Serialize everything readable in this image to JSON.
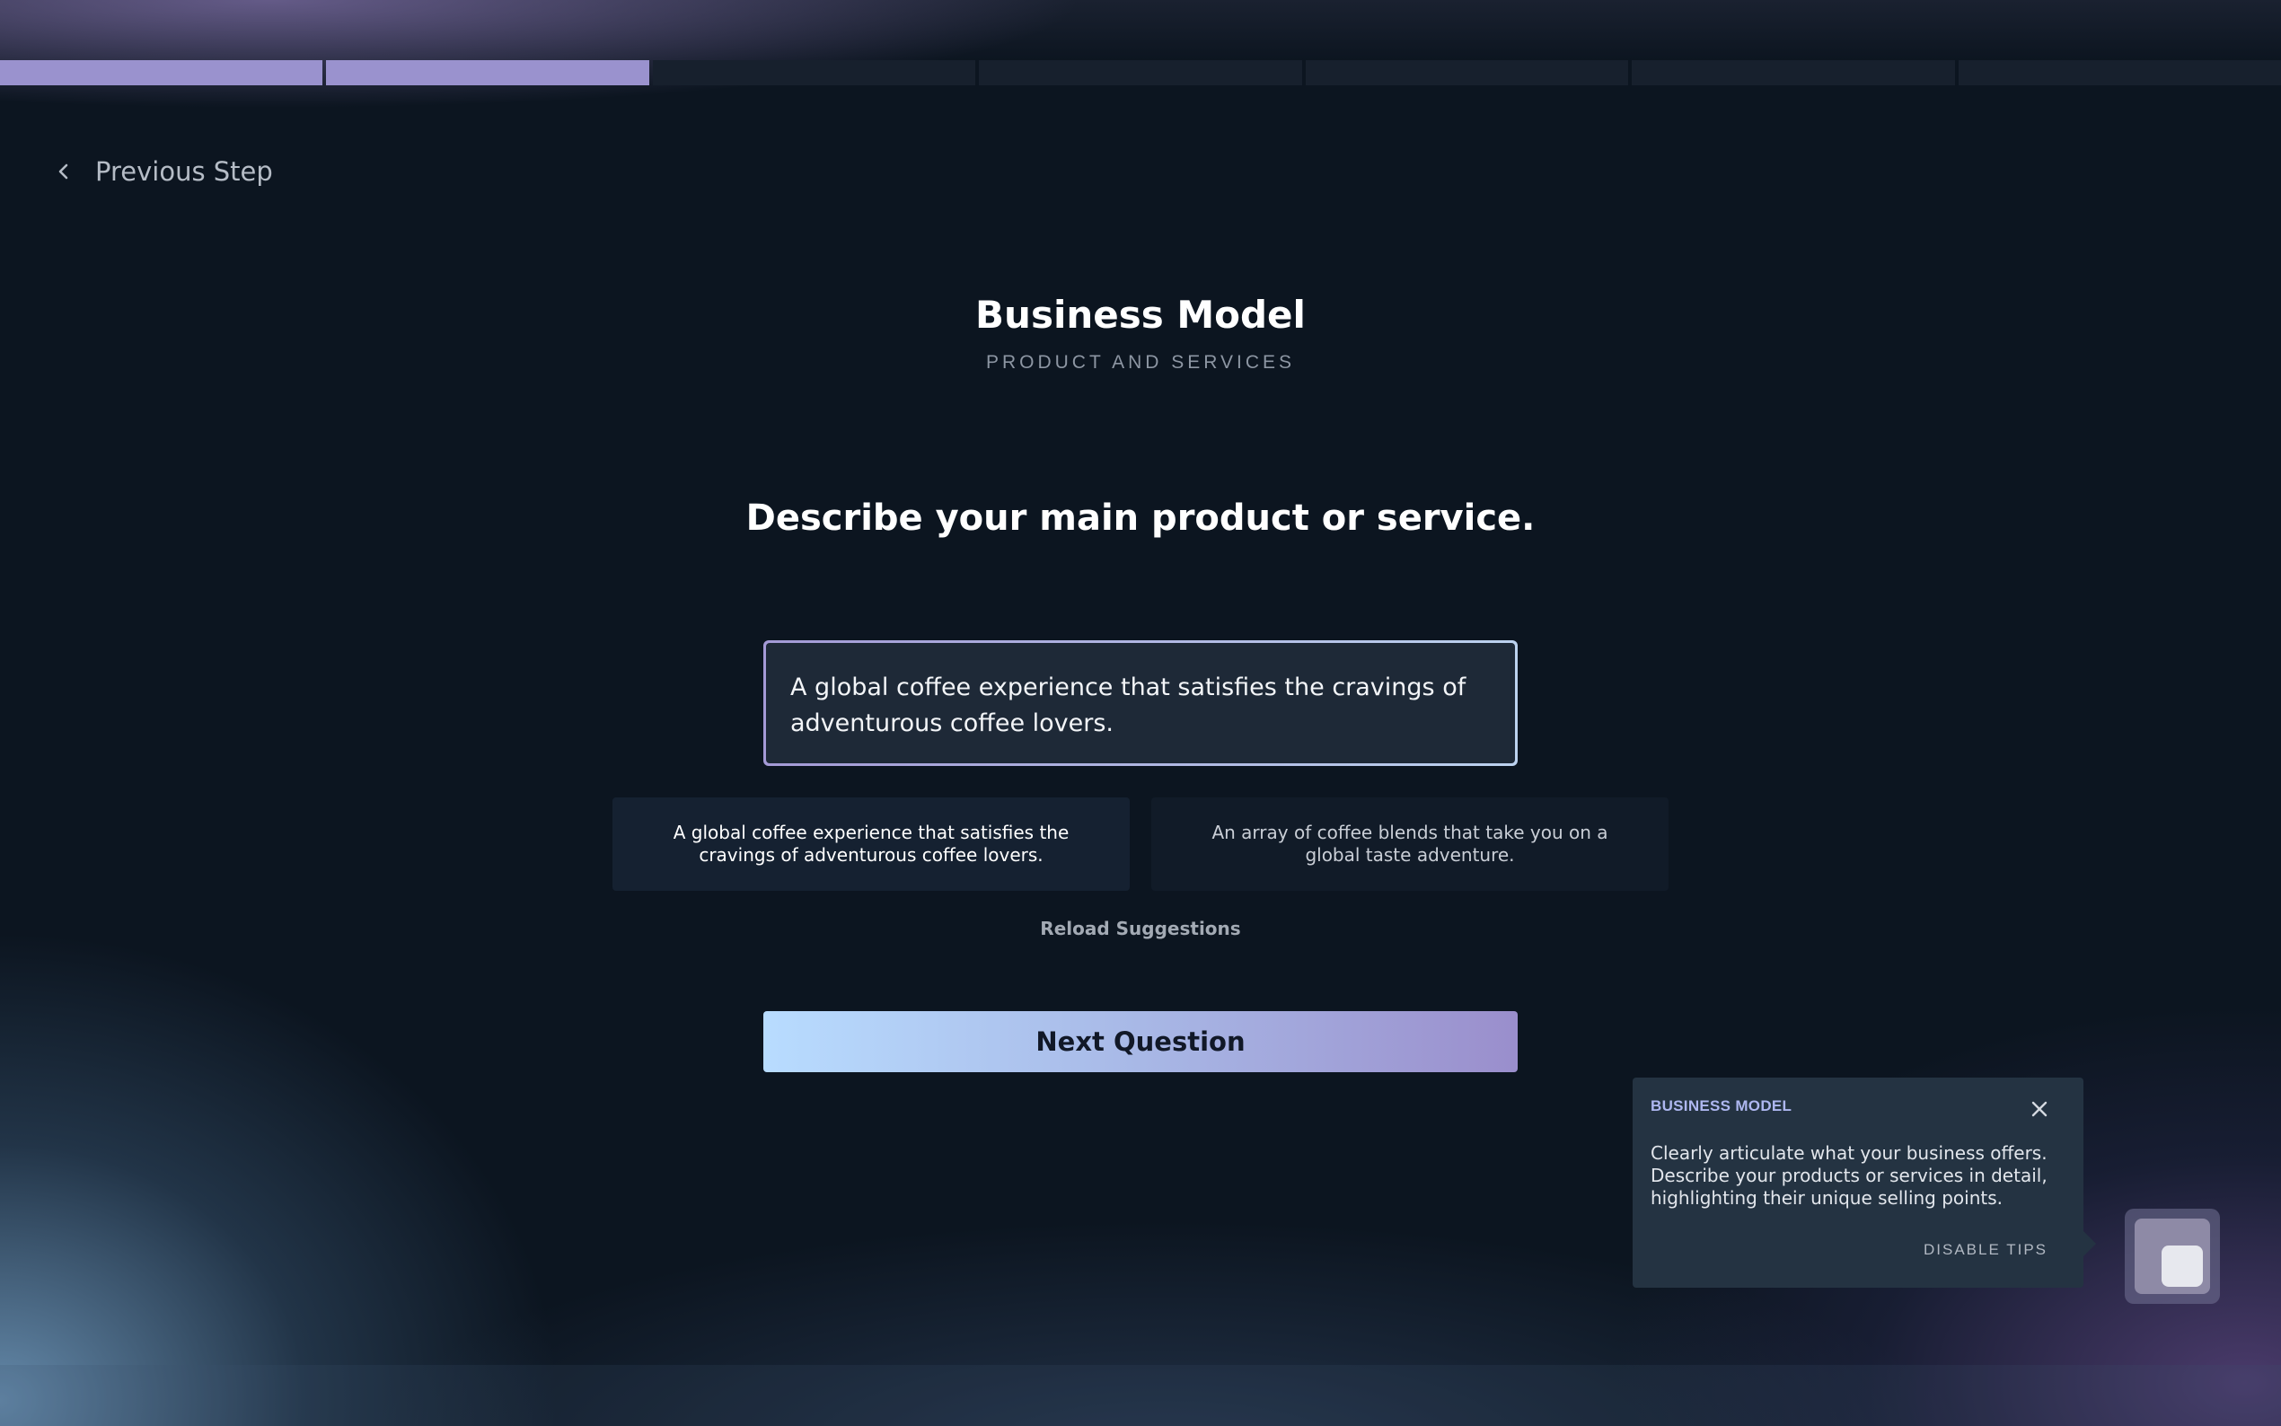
{
  "progress": {
    "total_steps": 7,
    "completed_steps": 2,
    "color_done": "#9a92ce",
    "color_todo": "#17202d"
  },
  "nav": {
    "previous_label": "Previous Step"
  },
  "header": {
    "title": "Business Model",
    "subtitle": "PRODUCT AND SERVICES"
  },
  "question": {
    "text": "Describe your main product or service."
  },
  "answer": {
    "value": "A global coffee experience that satisfies the cravings of adventurous coffee lovers."
  },
  "suggestions": [
    {
      "text": "A global coffee experience that satisfies the cravings of adventurous coffee lovers."
    },
    {
      "text": "An array of coffee blends that take you on a global taste adventure."
    }
  ],
  "reload_label": "Reload Suggestions",
  "next_label": "Next Question",
  "tip": {
    "heading": "BUSINESS MODEL",
    "body": "Clearly articulate what your business offers. Describe your products or services in detail, highlighting their unique selling points.",
    "disable_label": "DISABLE TIPS"
  },
  "icons": {
    "back": "chevron-left-icon",
    "close": "close-icon",
    "assistant": "assistant-icon"
  },
  "colors": {
    "accent_gradient_start": "#b8dcff",
    "accent_gradient_end": "#9a8ecc",
    "background": "#0c1520",
    "tip_background": "#243342"
  }
}
